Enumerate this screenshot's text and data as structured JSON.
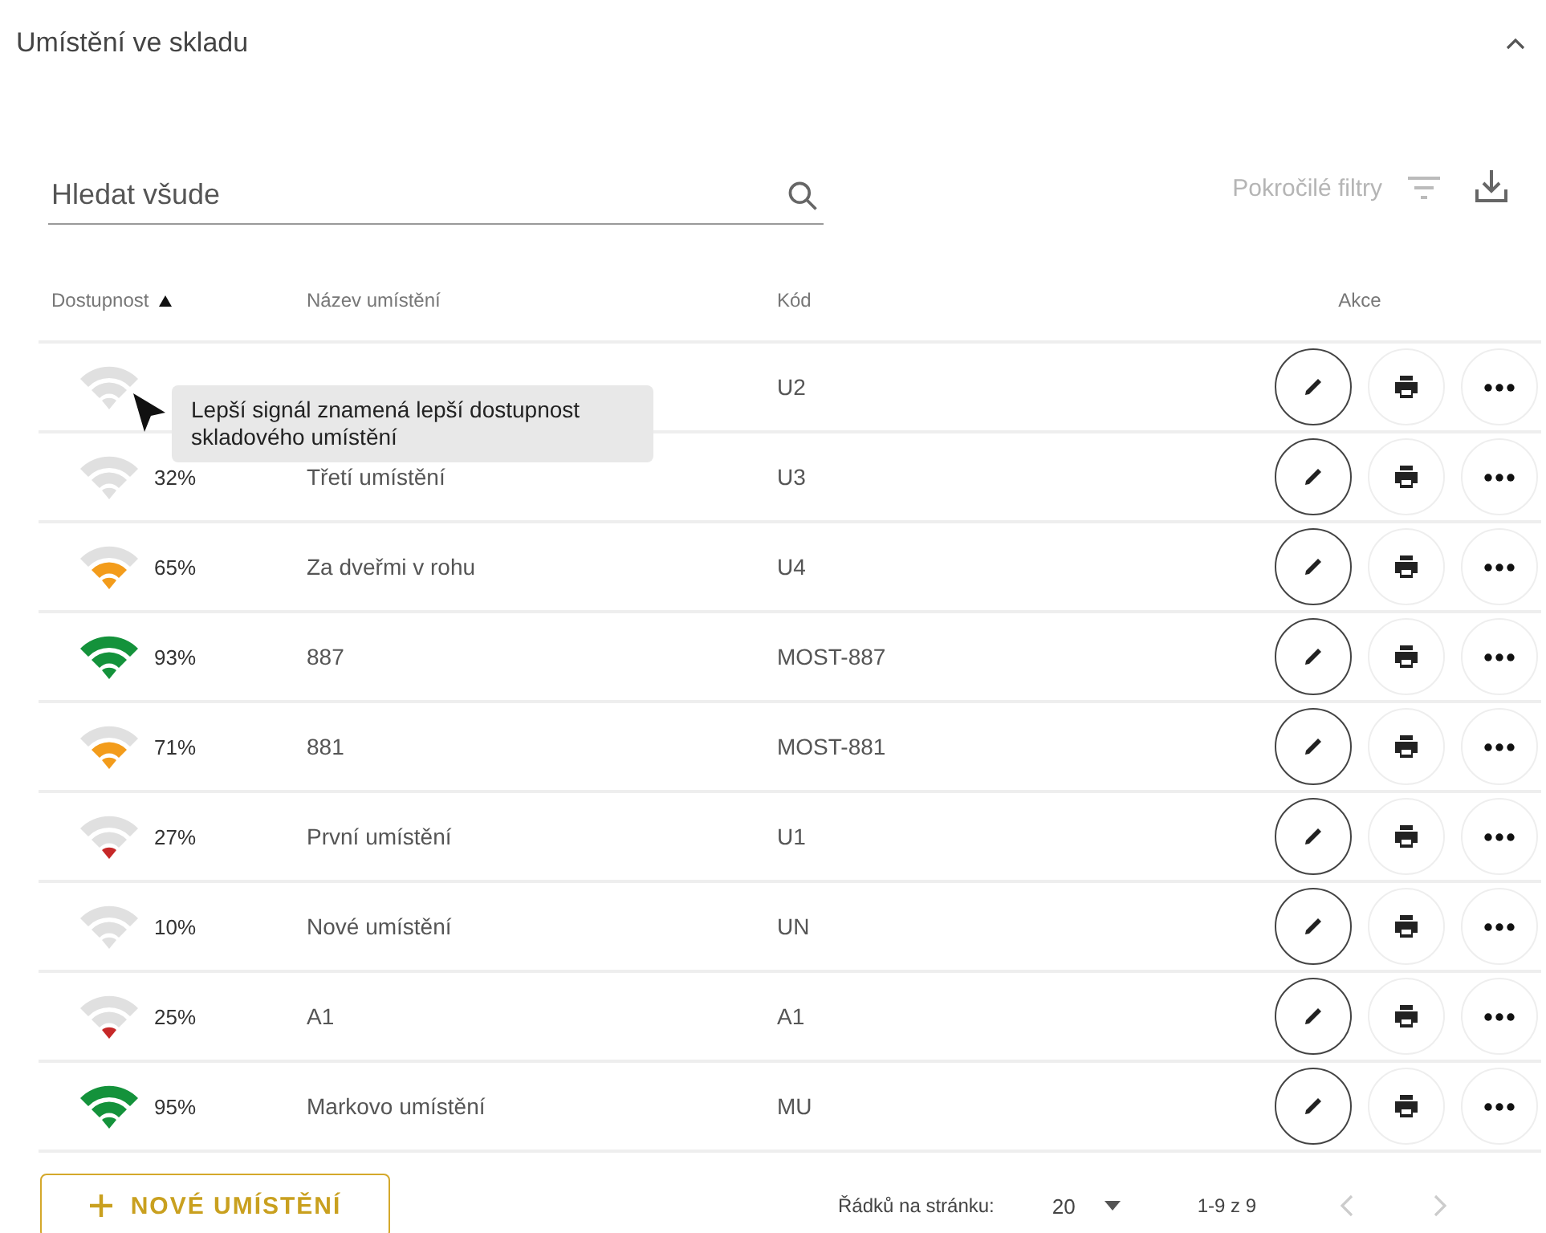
{
  "section": {
    "title": "Umístění ve skladu",
    "expanded": true
  },
  "search": {
    "placeholder": "Hledat všude"
  },
  "advanced_filters": "Pokročilé filtry",
  "table": {
    "columns": [
      {
        "label": "Dostupnost",
        "sorted": true
      },
      {
        "label": "Název umístění",
        "sorted": false
      },
      {
        "label": "Kód",
        "sorted": false
      },
      {
        "label": "Akce",
        "sorted": false
      }
    ],
    "rows": [
      {
        "kind": "none",
        "code": "U2"
      },
      {
        "kind": "none",
        "percent": "32%",
        "name": "Třetí umístění",
        "code": "U3"
      },
      {
        "kind": "medium",
        "percent": "65%",
        "name": "Za dveřmi v rohu",
        "code": "U4"
      },
      {
        "kind": "high",
        "percent": "93%",
        "name": "887",
        "code": "MOST-887"
      },
      {
        "kind": "medium",
        "percent": "71%",
        "name": "881",
        "code": "MOST-881"
      },
      {
        "kind": "low",
        "percent": "27%",
        "name": "První umístění",
        "code": "U1"
      },
      {
        "kind": "none",
        "percent": "10%",
        "name": "Nové umístění",
        "code": "UN"
      },
      {
        "kind": "low",
        "percent": "25%",
        "name": "A1",
        "code": "A1"
      },
      {
        "kind": "high",
        "percent": "95%",
        "name": "Markovo umístění",
        "code": "MU"
      }
    ]
  },
  "tooltip": "Lepší signál znamená lepší dostupnost skladového umístění",
  "new_button": "NOVÉ UMÍSTĚNÍ",
  "pagination": {
    "rows_label": "Řádků na stránku:",
    "rows_value": "20",
    "range": "1-9 z 9"
  }
}
